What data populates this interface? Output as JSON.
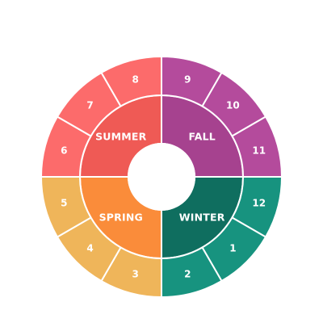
{
  "seasons": [
    {
      "name": "SUMMER",
      "color": "#ef5a55",
      "months": [
        {
          "label": "6",
          "color": "#fc6b6b"
        },
        {
          "label": "7",
          "color": "#fc6b6b"
        },
        {
          "label": "8",
          "color": "#fc6b6b"
        }
      ]
    },
    {
      "name": "FALL",
      "color": "#a6428f",
      "months": [
        {
          "label": "9",
          "color": "#b44b9c"
        },
        {
          "label": "10",
          "color": "#b44b9c"
        },
        {
          "label": "11",
          "color": "#b44b9c"
        }
      ]
    },
    {
      "name": "WINTER",
      "color": "#0f6e5f",
      "months": [
        {
          "label": "12",
          "color": "#17937f"
        },
        {
          "label": "1",
          "color": "#17937f"
        },
        {
          "label": "2",
          "color": "#17937f"
        }
      ]
    },
    {
      "name": "SPRING",
      "color": "#fa8c3a",
      "months": [
        {
          "label": "3",
          "color": "#efb55a"
        },
        {
          "label": "4",
          "color": "#efb55a"
        },
        {
          "label": "5",
          "color": "#efb55a"
        }
      ]
    }
  ]
}
